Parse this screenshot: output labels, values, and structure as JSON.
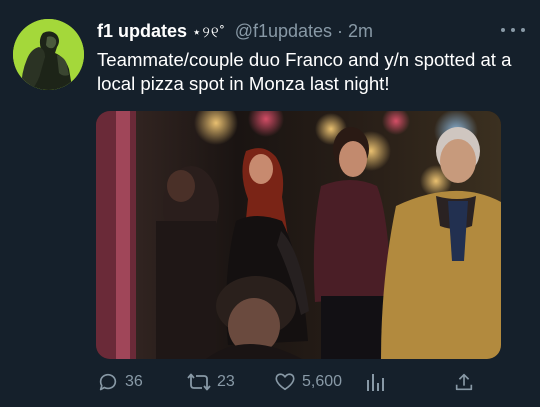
{
  "tweet": {
    "display_name": "f1 updates",
    "name_decoration": "⋆୨୧˚",
    "handle": "@f1updates",
    "separator": "·",
    "time": "2m",
    "text": "Teammate/couple duo Franco and y/n spotted at a local pizza spot in Monza last night!"
  },
  "actions": {
    "reply_count": "36",
    "retweet_count": "23",
    "like_count": "5,600"
  },
  "icons": {
    "more": "more-horizontal-icon",
    "reply": "reply-icon",
    "retweet": "retweet-icon",
    "like": "heart-icon",
    "analytics": "analytics-icon",
    "share": "share-icon"
  },
  "colors": {
    "background": "#15202b",
    "text_primary": "#ffffff",
    "text_secondary": "#8899a6",
    "avatar_bg": "#a4d83a"
  }
}
